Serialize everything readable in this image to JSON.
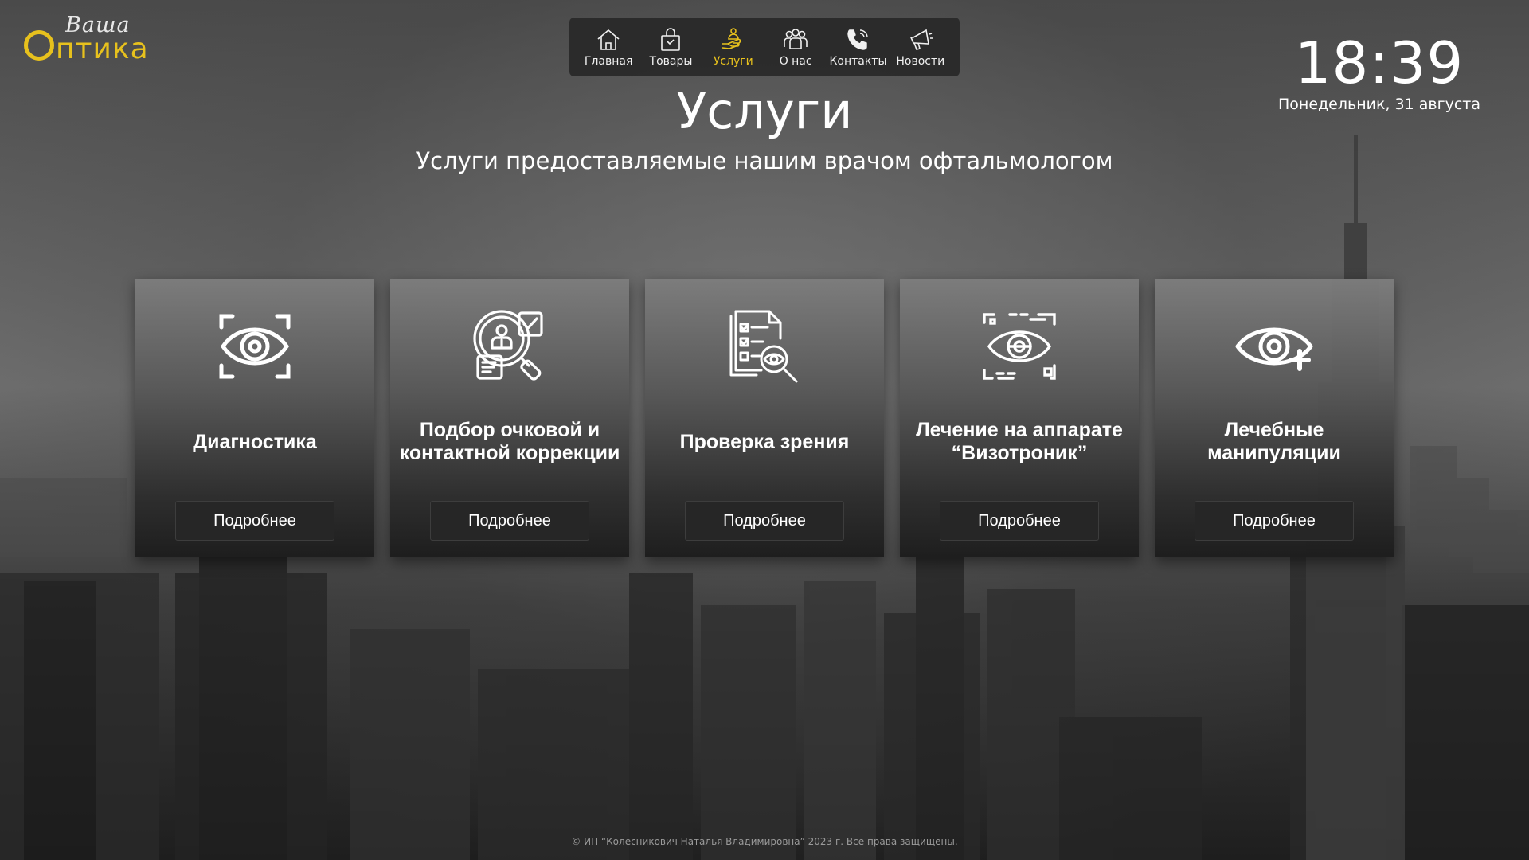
{
  "logo": {
    "script_text": "Ваша",
    "main_text": "птика"
  },
  "nav": {
    "items": [
      {
        "label": "Главная",
        "icon": "home-icon"
      },
      {
        "label": "Товары",
        "icon": "shopping-bag-icon"
      },
      {
        "label": "Услуги",
        "icon": "service-hand-icon",
        "active": true
      },
      {
        "label": "О нас",
        "icon": "team-icon"
      },
      {
        "label": "Контакты",
        "icon": "phone-icon"
      },
      {
        "label": "Новости",
        "icon": "megaphone-icon"
      }
    ],
    "active_color": "#e7c11d"
  },
  "clock": {
    "time": "18:39",
    "date": "Понедельник, 31 августа"
  },
  "page": {
    "title": "Услуги",
    "subtitle": "Услуги предоставляемые нашим врачом офтальмологом"
  },
  "cards": [
    {
      "title": "Диагностика",
      "button": "Подробнее",
      "icon": "eye-scan-icon"
    },
    {
      "title": "Подбор очковой и контактной коррекции",
      "button": "Подробнее",
      "icon": "doctor-search-icon"
    },
    {
      "title": "Проверка зрения",
      "button": "Подробнее",
      "icon": "eye-test-checklist-icon"
    },
    {
      "title": "Лечение на аппарате “Визотроник”",
      "button": "Подробнее",
      "icon": "eye-device-icon"
    },
    {
      "title": "Лечебные манипуляции",
      "button": "Подробнее",
      "icon": "eye-plus-icon"
    }
  ],
  "footer": {
    "text": "© ИП “Колесникович Наталья Владимировна” 2023 г. Все права защищены."
  },
  "colors": {
    "brand_yellow": "#e7c11d",
    "card_button_bg": "#262626"
  }
}
